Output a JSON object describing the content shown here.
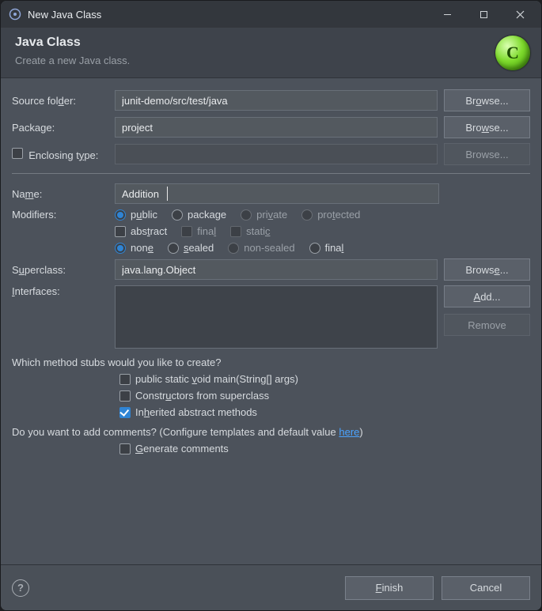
{
  "window": {
    "title": "New Java Class"
  },
  "banner": {
    "heading": "Java Class",
    "sub": "Create a new Java class.",
    "orb_letter": "C"
  },
  "labels": {
    "source_folder": "Source folder:",
    "package": "Package:",
    "enclosing": "Enclosing type:",
    "name": "Name:",
    "modifiers": "Modifiers:",
    "superclass": "Superclass:",
    "interfaces": "Interfaces:"
  },
  "fields": {
    "source_folder": "junit-demo/src/test/java",
    "package": "project",
    "enclosing": "",
    "name": "Addition",
    "superclass": "java.lang.Object"
  },
  "buttons": {
    "browse": "Browse...",
    "browse_u": "Browse...",
    "add": "Add...",
    "remove": "Remove",
    "finish": "Finish",
    "cancel": "Cancel"
  },
  "modifiers": {
    "vis": {
      "public": "public",
      "package": "package",
      "private": "private",
      "protected": "protected"
    },
    "flags": {
      "abstract": "abstract",
      "final": "final",
      "static": "static"
    },
    "seal": {
      "none": "none",
      "sealed": "sealed",
      "nonsealed": "non-sealed",
      "final": "final"
    }
  },
  "stubs": {
    "question": "Which method stubs would you like to create?",
    "main": "public static void main(String[] args)",
    "ctors": "Constructors from superclass",
    "inherited": "Inherited abstract methods"
  },
  "comments": {
    "question_pre": "Do you want to add comments? (Configure templates and default value ",
    "here": "here",
    "question_post": ")",
    "generate": "Generate comments"
  }
}
